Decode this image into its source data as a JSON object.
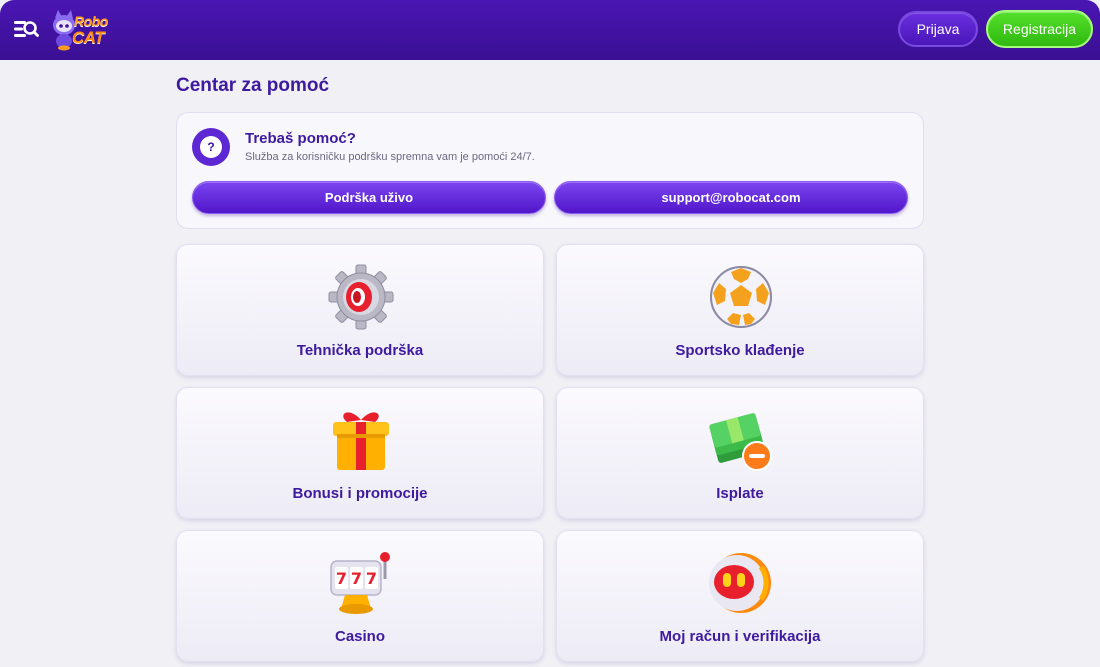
{
  "header": {
    "logo_line1": "Robo",
    "logo_line2": "CAT",
    "login_label": "Prijava",
    "register_label": "Registracija"
  },
  "page": {
    "title": "Centar za pomoć"
  },
  "help": {
    "title": "Trebaš pomoć?",
    "subtitle": "Služba za korisničku podršku spremna vam je pomoći 24/7.",
    "live_label": "Podrška uživo",
    "email_label": "support@robocat.com",
    "icon_glyph": "?"
  },
  "categories": [
    {
      "label": "Tehnička podrška",
      "icon": "gear-icon"
    },
    {
      "label": "Sportsko klađenje",
      "icon": "soccer-ball-icon"
    },
    {
      "label": "Bonusi i promocije",
      "icon": "gift-icon"
    },
    {
      "label": "Isplate",
      "icon": "cash-withdraw-icon"
    },
    {
      "label": "Casino",
      "icon": "slot-machine-icon"
    },
    {
      "label": "Moj račun i verifikacija",
      "icon": "robot-account-icon"
    }
  ],
  "colors": {
    "header": "#4a16b3",
    "accent": "#3d1a9e",
    "register": "#3fc81a"
  }
}
